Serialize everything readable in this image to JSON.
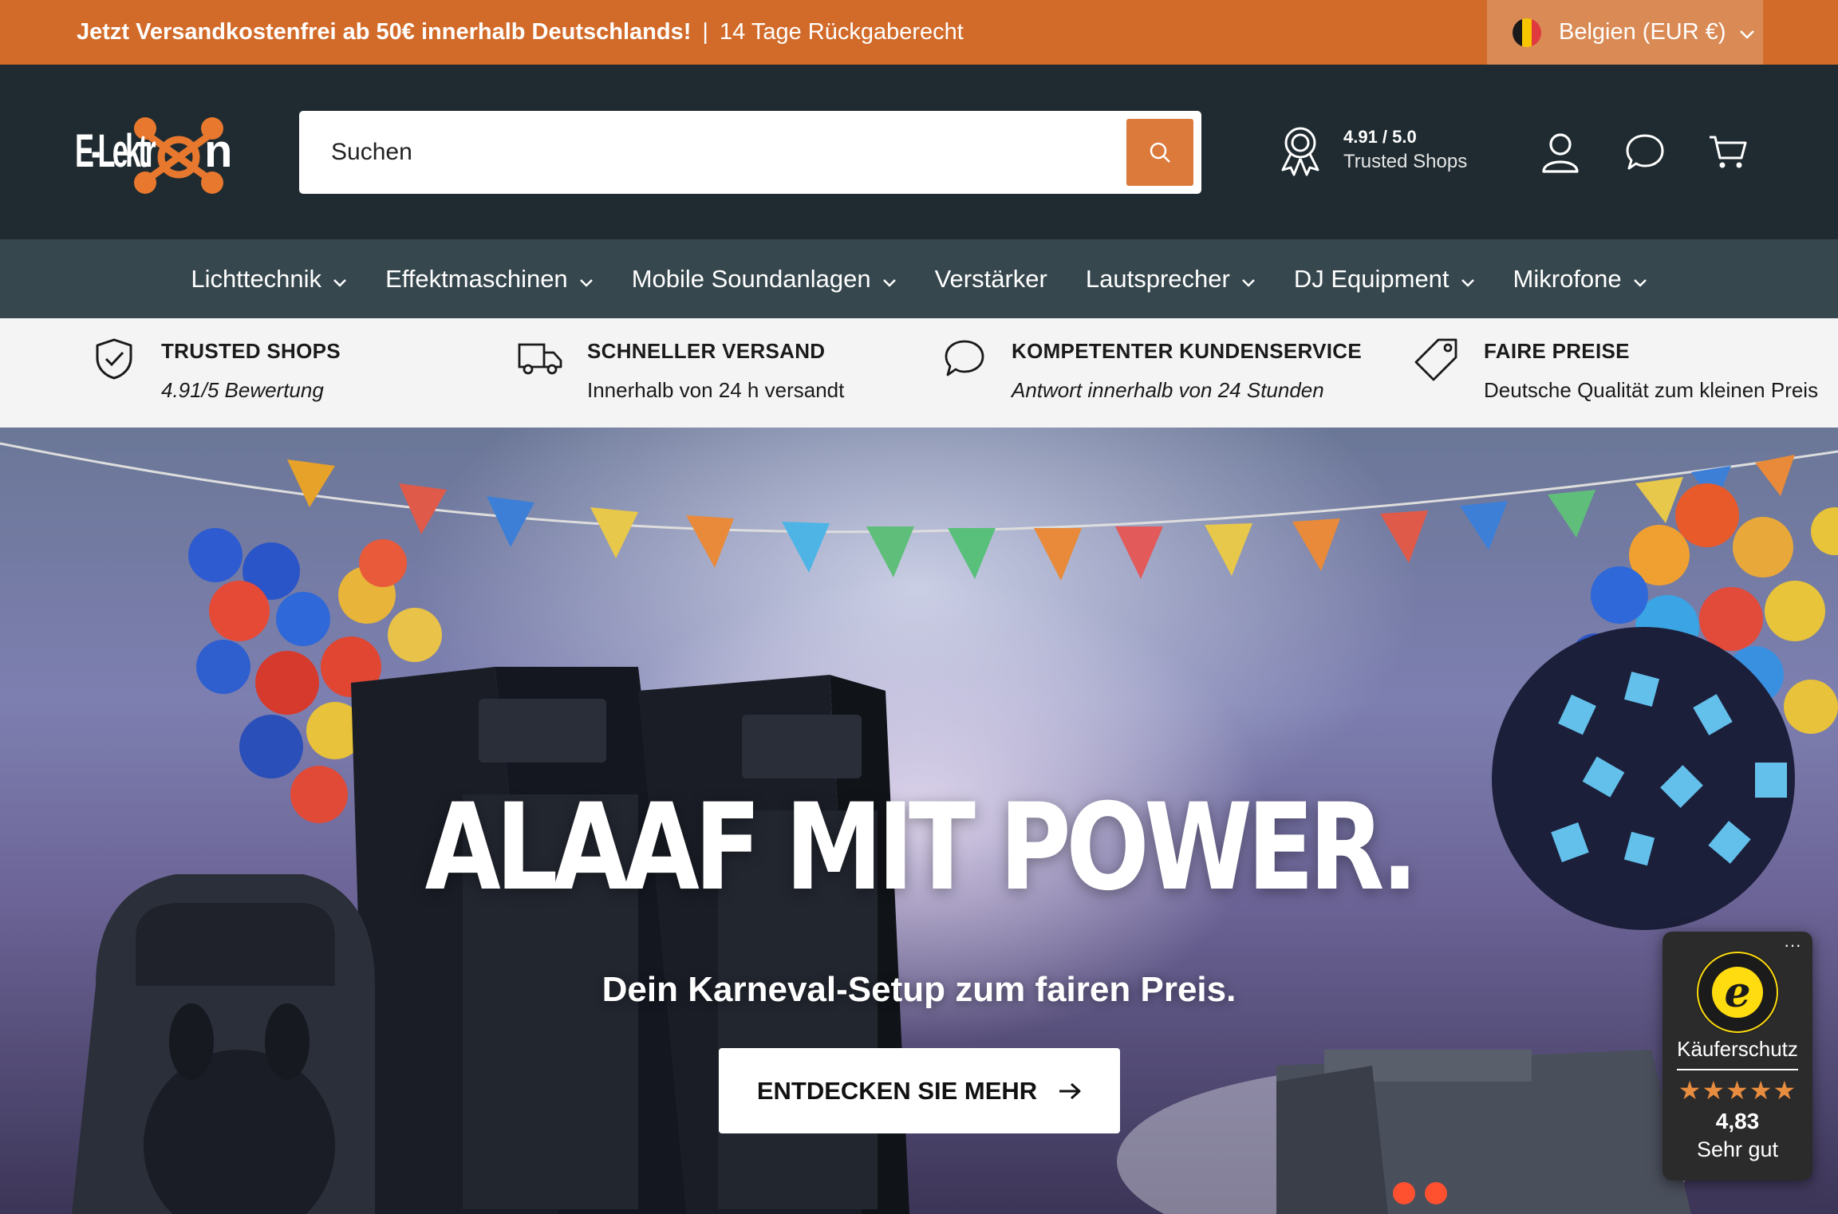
{
  "announcement": {
    "promo_bold": "Jetzt Versandkostenfrei ab 50€ innerhalb Deutschlands!",
    "separator": "|",
    "promo_rest": "14 Tage Rückgaberecht",
    "country_label": "Belgien (EUR €)"
  },
  "header": {
    "logo_text": "E-Lektron",
    "search_placeholder": "Suchen",
    "trust_score": "4.91 / 5.0",
    "trust_name": "Trusted Shops"
  },
  "nav": {
    "items": [
      {
        "label": "Lichttechnik"
      },
      {
        "label": "Effektmaschinen"
      },
      {
        "label": "Mobile Soundanlagen"
      },
      {
        "label": "Verstärker"
      },
      {
        "label": "Lautsprecher"
      },
      {
        "label": "DJ Equipment"
      },
      {
        "label": "Mikrofone"
      }
    ]
  },
  "usp": {
    "items": [
      {
        "icon": "shield-check-icon",
        "title": "TRUSTED SHOPS",
        "subtitle": "4.91/5 Bewertung"
      },
      {
        "icon": "truck-icon",
        "title": "SCHNELLER VERSAND",
        "subtitle": "Innerhalb von 24 h versandt"
      },
      {
        "icon": "chat-icon",
        "title": "KOMPETENTER KUNDENSERVICE",
        "subtitle": "Antwort innerhalb von 24 Stunden"
      },
      {
        "icon": "price-tag-icon",
        "title": "FAIRE PREISE",
        "subtitle": "Deutsche Qualität zum kleinen Preis"
      }
    ]
  },
  "hero": {
    "headline": "ALAAF MIT POWER.",
    "subline": "Dein Karneval-Setup zum fairen Preis.",
    "cta_label": "ENTDECKEN SIE MEHR"
  },
  "badge": {
    "title": "Käuferschutz",
    "stars": "★★★★★",
    "rating": "4,83",
    "rating_text": "Sehr gut",
    "menu": "···"
  },
  "colors": {
    "announcement_bg": "#d26b2a",
    "header_bg": "#1f2b30",
    "nav_bg": "#37474e",
    "accent": "#dc7a3c",
    "usp_bg": "#f4f4f4"
  }
}
